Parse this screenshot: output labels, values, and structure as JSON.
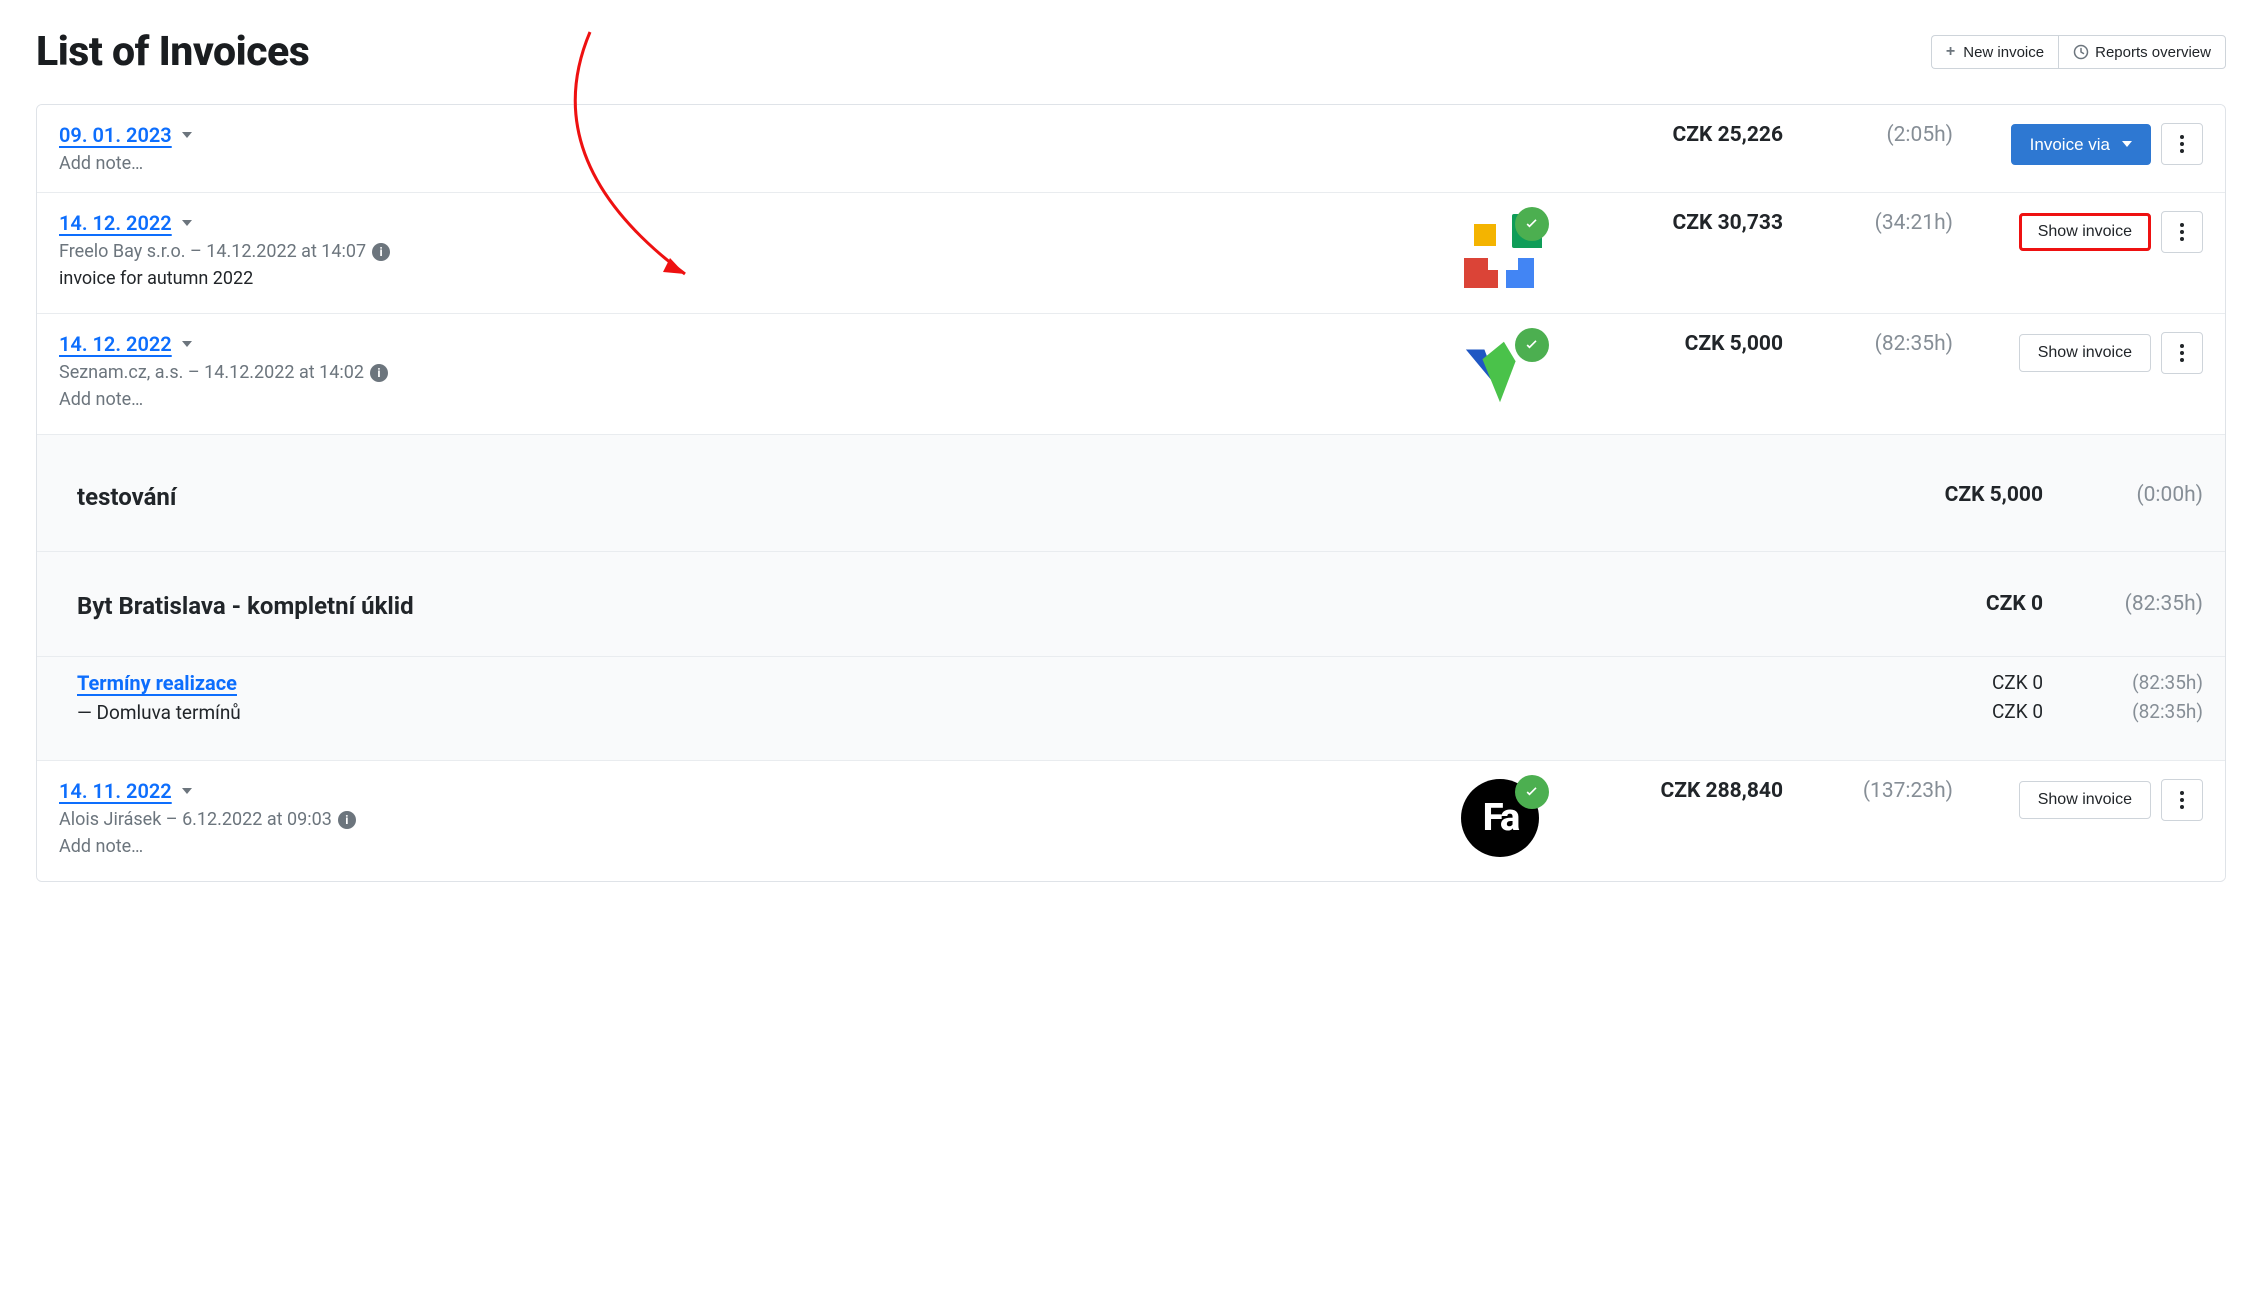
{
  "page": {
    "title": "List of Invoices",
    "newInvoice": "New invoice",
    "reports": "Reports overview"
  },
  "rows": [
    {
      "date": "09. 01. 2023",
      "note": "Add note…",
      "amount": "CZK 25,226",
      "time": "(2:05h)",
      "primaryAction": "Invoice via"
    },
    {
      "date": "14. 12. 2022",
      "meta": "Freelo Bay s.r.o. – 14.12.2022 at 14:07",
      "desc": "invoice for autumn 2022",
      "amount": "CZK 30,733",
      "time": "(34:21h)",
      "secondaryAction": "Show invoice"
    },
    {
      "date": "14. 12. 2022",
      "meta": "Seznam.cz, a.s. – 14.12.2022 at 14:02",
      "note": "Add note…",
      "amount": "CZK 5,000",
      "time": "(82:35h)",
      "secondaryAction": "Show invoice"
    }
  ],
  "group": {
    "name": "testování",
    "amount": "CZK 5,000",
    "time": "(0:00h)"
  },
  "project": {
    "name": "Byt Bratislava - kompletní úklid",
    "amount": "CZK 0",
    "time": "(82:35h)",
    "task": {
      "name": "Termíny realizace",
      "sub": "— Domluva termínů",
      "line1": {
        "amount": "CZK 0",
        "time": "(82:35h)"
      },
      "line2": {
        "amount": "CZK 0",
        "time": "(82:35h)"
      }
    }
  },
  "lastRow": {
    "date": "14. 11. 2022",
    "meta": "Alois Jirásek – 6.12.2022 at 09:03",
    "note": "Add note…",
    "amount": "CZK 288,840",
    "time": "(137:23h)",
    "secondaryAction": "Show invoice"
  }
}
